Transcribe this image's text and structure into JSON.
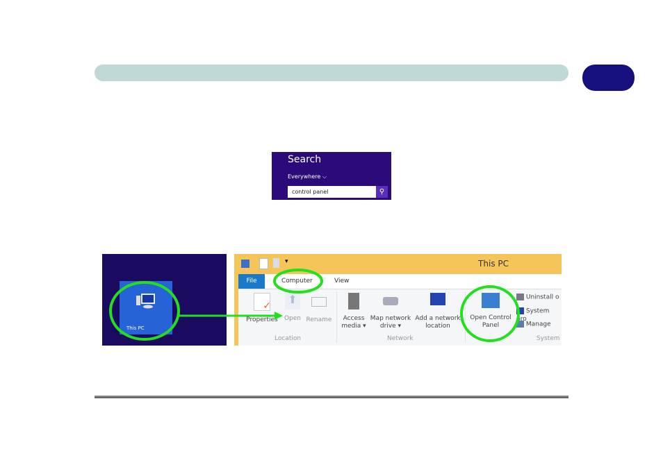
{
  "search_panel": {
    "title": "Search",
    "scope": "Everywhere",
    "scope_chevron": "⌵",
    "query": "control panel",
    "search_icon": "magnifier-icon"
  },
  "start_screen": {
    "tile_label": "This PC",
    "tile_icon": "computer-icon"
  },
  "explorer": {
    "window_title": "This PC",
    "tabs": [
      {
        "label": "File"
      },
      {
        "label": "Computer"
      },
      {
        "label": "View"
      }
    ],
    "groups": [
      {
        "name": "Location",
        "items": [
          "Properties",
          "Open",
          "Rename"
        ]
      },
      {
        "name": "Network",
        "items": [
          "Access media ▾",
          "Map network drive ▾",
          "Add a network location"
        ]
      },
      {
        "name": "System",
        "items": [
          "Open Control Panel",
          "Uninstall o",
          "System pro",
          "Manage"
        ]
      }
    ]
  },
  "colors": {
    "highlight": "#22e01e",
    "header_bar": "#c0d8d6",
    "chapter_pill": "#16107f"
  }
}
